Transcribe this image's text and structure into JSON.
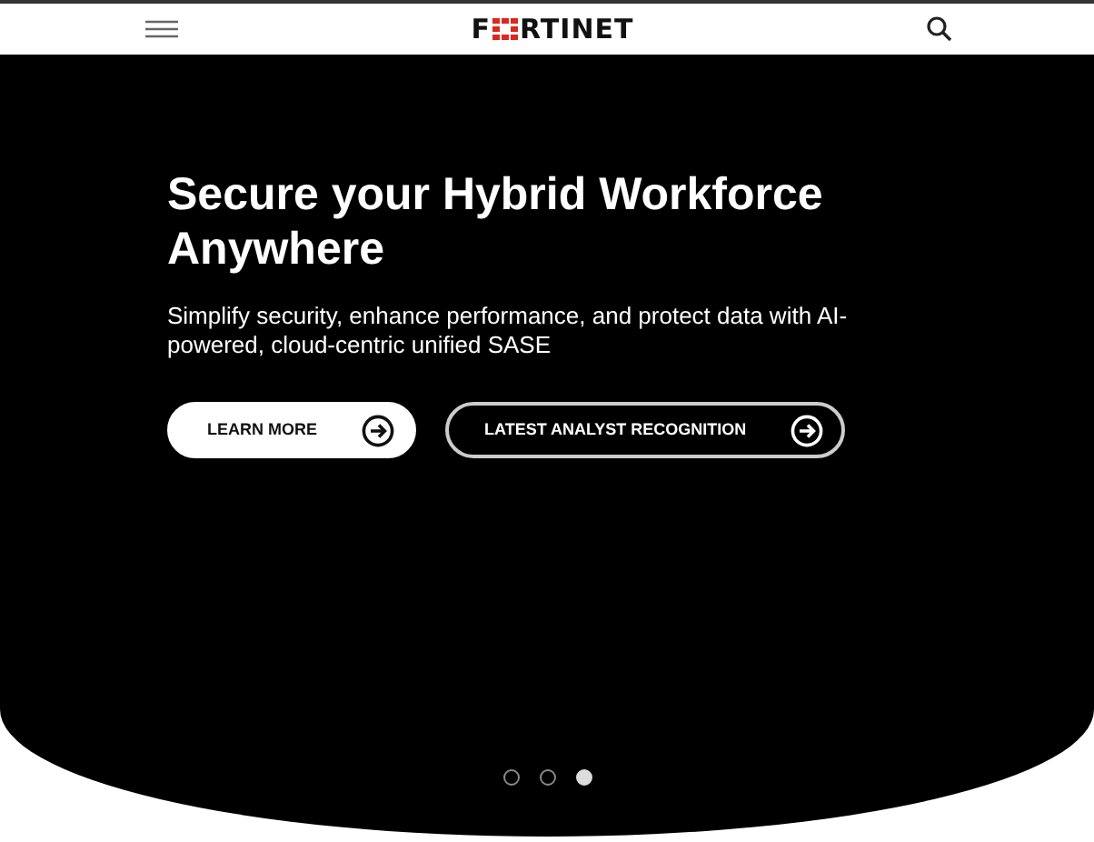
{
  "header": {
    "logo": {
      "before": "F",
      "after": "RTINET"
    }
  },
  "hero": {
    "title": "Secure your Hybrid Workforce Anywhere",
    "subtitle": "Simplify security, enhance performance, and protect data with AI-powered, cloud-centric unified SASE",
    "buttons": [
      {
        "label": "LEARN MORE",
        "kind": "filled"
      },
      {
        "label": "LATEST ANALYST RECOGNITION",
        "kind": "outline"
      }
    ],
    "slides": [
      {
        "selected": false
      },
      {
        "selected": false
      },
      {
        "selected": true
      }
    ]
  }
}
